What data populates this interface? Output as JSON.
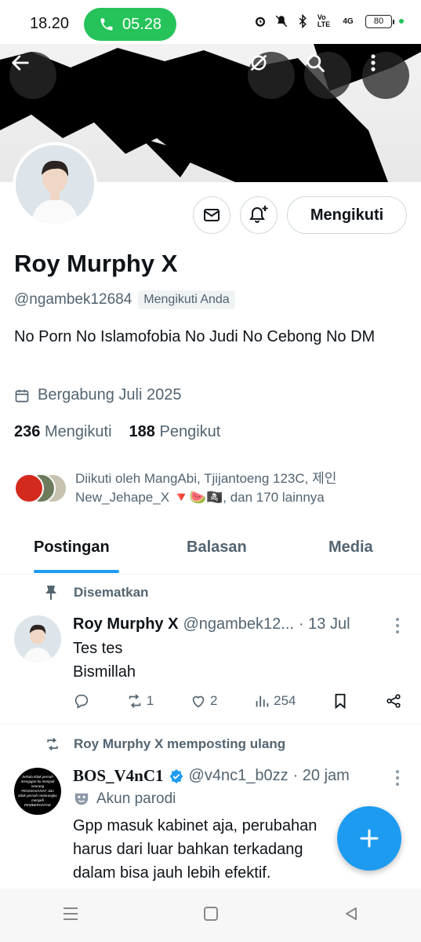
{
  "status_bar": {
    "time": "18.20",
    "call_timer": "05.28",
    "network": "4G",
    "battery": "80"
  },
  "profile": {
    "name": "Roy Murphy X",
    "handle": "@ngambek12684",
    "follows_you_badge": "Mengikuti Anda",
    "bio": "No Porn No Islamofobia No Judi No Cebong No DM",
    "joined": "Bergabung Juli 2025",
    "following_count": "236",
    "following_label": "Mengikuti",
    "followers_count": "188",
    "followers_label": "Pengikut",
    "followed_by_line1": "Diikuti oleh MangAbi, Tjijantoeng 123C, 제인",
    "followed_by_line2": "New_Jehape_X 🔻🍉🏴‍☠️, dan 170 lainnya",
    "follow_button": "Mengikuti"
  },
  "tabs": [
    "Postingan",
    "Balasan",
    "Media"
  ],
  "posts": [
    {
      "context": "Disematkan",
      "name": "Roy Murphy X",
      "handle": "@ngambek12...",
      "time": "· 13 Jul",
      "text_line1": "Tes tes",
      "text_line2": "Bismillah",
      "reposts": "1",
      "likes": "2",
      "views": "254"
    },
    {
      "context": "Roy Murphy X memposting ulang",
      "name": "BOS_V4nC1",
      "handle": "@v4nc1_b0zz",
      "time": "· 20 jam",
      "parody_label": "Akun parodi",
      "text_line1": "Gpp masuk kabinet aja, perubahan",
      "text_line2": "harus dari luar bahkan terkadang",
      "text_line3": "dalam bisa jauh lebih efektif.",
      "avatar_text": "Sekalu tidak pernah mengajari ku menjadi seorang PENGKHIANAT, dan tidak pernah melarangku menjadi PEMBERONTAK"
    }
  ],
  "colors": {
    "accent": "#1d9bf0",
    "call_green": "#25c35a",
    "muted": "#536471"
  }
}
